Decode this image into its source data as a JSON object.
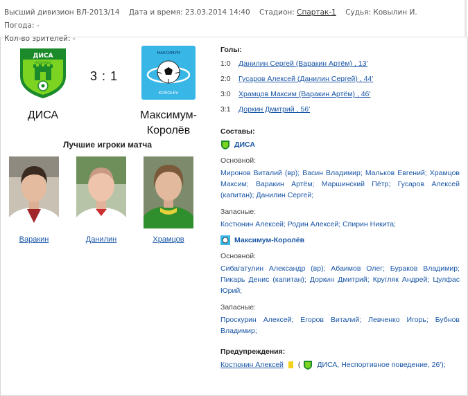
{
  "match_info": {
    "division": "Высший дивизион ВЛ-2013/14",
    "datetime": "Дата и время: 23.03.2014 14:40",
    "stadium_label": "Стадион:",
    "stadium": "Спартак-1",
    "referee": "Судья: Ковылин И.",
    "weather": "Погода: -",
    "spectators": "Кол-во зрителей: -"
  },
  "home_team": {
    "name": "ДИСА",
    "logo_text": "ДИСА",
    "logo_subtext": "НАДЕЖДА"
  },
  "away_team": {
    "name_line1": "Максимум-",
    "name_line2": "Королёв",
    "logo_top": "МАКСИМУМ",
    "logo_bottom": "KOROLEV"
  },
  "score": "3 : 1",
  "best_players": {
    "title": "Лучшие игроки матча",
    "players": [
      "Варакин",
      "Данилин",
      "Храмцов"
    ]
  },
  "goals": {
    "title": "Голы:",
    "rows": [
      {
        "score": "1:0",
        "text": "Данилин Сергей (Варакин Артём) , 13'"
      },
      {
        "score": "2:0",
        "text": "Гусаров Алексей (Данилин Сергей) , 44'"
      },
      {
        "score": "3:0",
        "text": "Храмцов Максим (Варакин Артём) , 46'"
      },
      {
        "score": "3:1",
        "text": "Доркин Дмитрий , 56'"
      }
    ]
  },
  "lineups": {
    "title": "Составы:",
    "home": {
      "name": "ДИСА",
      "main_label": "Основной:",
      "main": "Миронов Виталий (вр); Васин Владимир; Мальков Евгений; Храмцов Максим; Варакин Артём; Маршинский Пётр; Гусаров Алексей (капитан); Данилин Сергей;",
      "subs_label": "Запасные:",
      "subs": "Костюнин Алексей; Родин Алексей; Спирин Никита;"
    },
    "away": {
      "name": "Максимум-Королёв",
      "main_label": "Основной:",
      "main": "Сибагатулин Александр (вр); Абаимов Олег; Бураков Владимир; Пикарь Денис (капитан); Доркин Дмитрий; Кругляк Андрей; Цулфас Юрий;",
      "subs_label": "Запасные:",
      "subs": "Проскурин Алексей; Егоров Виталий; Левченко Игорь; Бубнов Владимир;"
    }
  },
  "warnings": {
    "title": "Предупреждения:",
    "player": "Костюнин Алексей",
    "open": "(",
    "detail": "ДИСА, Неспортивное поведение, 26');"
  },
  "colors": {
    "link": "#1a56a6",
    "disa_green": "#1b8a2b",
    "disa_bright": "#7dd321",
    "maximum_blue": "#38b6e6",
    "yellow_card": "#f2d21a"
  }
}
